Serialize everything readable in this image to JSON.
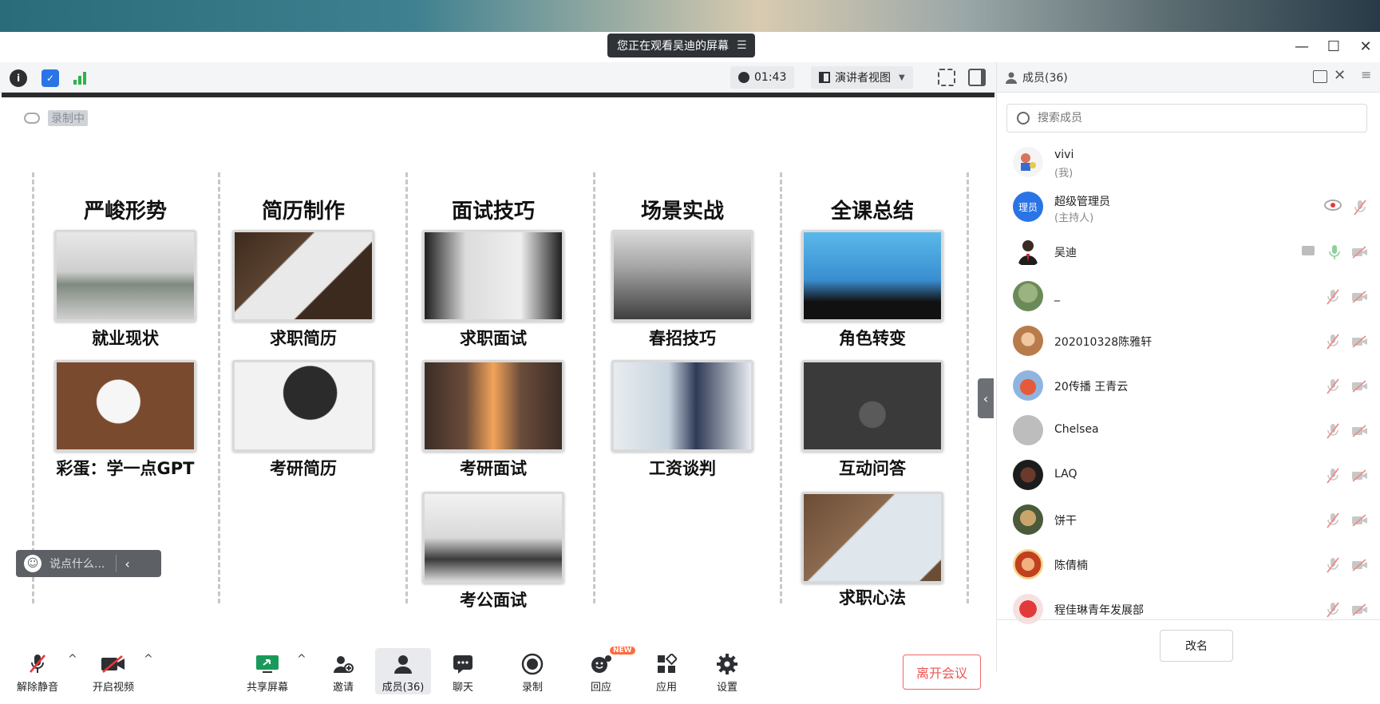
{
  "banner": {
    "text": "您正在观看吴迪的屏幕"
  },
  "toolbar": {
    "timer": "01:43",
    "view_mode": "演讲者视图"
  },
  "recording": {
    "label": "录制中"
  },
  "slide": {
    "columns": [
      {
        "title": "严峻形势",
        "cards": [
          "就业现状",
          "彩蛋：学一点GPT"
        ]
      },
      {
        "title": "简历制作",
        "cards": [
          "求职简历",
          "考研简历"
        ]
      },
      {
        "title": "面试技巧",
        "cards": [
          "求职面试",
          "考研面试",
          "考公面试"
        ]
      },
      {
        "title": "场景实战",
        "cards": [
          "春招技巧",
          "工资谈判"
        ]
      },
      {
        "title": "全课总结",
        "cards": [
          "角色转变",
          "互动问答",
          "求职心法"
        ]
      }
    ]
  },
  "chat_pill": {
    "placeholder": "说点什么..."
  },
  "bottom": {
    "unmute": "解除静音",
    "start_video": "开启视频",
    "share": "共享屏幕",
    "invite": "邀请",
    "members": "成员(36)",
    "chat": "聊天",
    "record": "录制",
    "reactions": "回应",
    "reactions_badge": "NEW",
    "apps": "应用",
    "settings": "设置",
    "leave": "离开会议"
  },
  "panel": {
    "title": "成员(36)",
    "search_placeholder": "搜索成员",
    "rename": "改名",
    "members": [
      {
        "name": "vivi",
        "sub": "(我)",
        "avatar_text": ""
      },
      {
        "name": "超级管理员",
        "sub": "(主持人)",
        "avatar_text": "理员"
      },
      {
        "name": "吴迪",
        "sub": "",
        "avatar_text": ""
      },
      {
        "name": "_",
        "sub": "",
        "avatar_text": ""
      },
      {
        "name": "202010328陈雅轩",
        "sub": "",
        "avatar_text": ""
      },
      {
        "name": "20传播 王青云",
        "sub": "",
        "avatar_text": ""
      },
      {
        "name": "Chelsea",
        "sub": "",
        "avatar_text": ""
      },
      {
        "name": "LAQ",
        "sub": "",
        "avatar_text": ""
      },
      {
        "name": "饼干",
        "sub": "",
        "avatar_text": ""
      },
      {
        "name": "陈倩楠",
        "sub": "",
        "avatar_text": ""
      },
      {
        "name": "程佳琳青年发展部",
        "sub": "",
        "avatar_text": ""
      }
    ]
  },
  "colors": {
    "accent_blue": "#2a74e6",
    "leave_red": "#e55555",
    "banner_bg": "#2f3337",
    "badge_orange": "#ff6a3d"
  }
}
